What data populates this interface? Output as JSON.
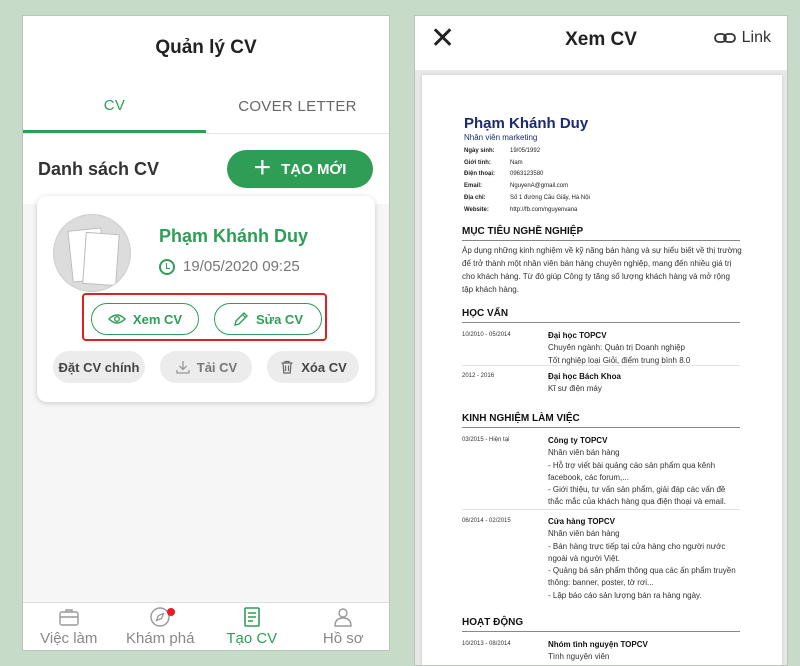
{
  "left": {
    "title": "Quản lý CV",
    "tabs": [
      {
        "label": "CV"
      },
      {
        "label": "COVER LETTER"
      }
    ],
    "section_title": "Danh sách CV",
    "create_label": "TẠO MỚI",
    "card": {
      "name": "Phạm Khánh Duy",
      "date": "19/05/2020 09:25",
      "view_label": "Xem CV",
      "edit_label": "Sửa CV",
      "set_main_label": "Đặt CV chính",
      "download_label": "Tải CV",
      "delete_label": "Xóa CV"
    },
    "nav": [
      {
        "label": "Việc làm",
        "icon": "briefcase-icon"
      },
      {
        "label": "Khám phá",
        "icon": "compass-icon"
      },
      {
        "label": "Tạo CV",
        "icon": "document-icon"
      },
      {
        "label": "Hồ sơ",
        "icon": "user-icon"
      }
    ]
  },
  "right": {
    "title": "Xem CV",
    "link_label": "Link",
    "cv": {
      "name": "Phạm Khánh Duy",
      "role": "Nhân viên marketing",
      "info": [
        {
          "k": "Ngày sinh:",
          "v": "19/05/1992"
        },
        {
          "k": "Giới tính:",
          "v": "Nam"
        },
        {
          "k": "Điện thoại:",
          "v": "0963123580"
        },
        {
          "k": "Email:",
          "v": "NguyenA@gmail.com"
        },
        {
          "k": "Địa chỉ:",
          "v": "Số 1 đường Cầu Giấy, Hà Nội"
        },
        {
          "k": "Website:",
          "v": "http://fb.com/nguyenvana"
        }
      ],
      "objective_title": "MỤC TIÊU NGHỀ NGHIỆP",
      "objective": "Áp dụng những kinh nghiệm về kỹ năng bán hàng và sự hiểu biết về thị trường để trở thành một nhân viên bán hàng chuyên nghiệp, mang đến nhiều giá trị cho khách hàng. Từ đó giúp Công ty tăng số lượng khách hàng và mở rộng tập khách hàng.",
      "education_title": "HỌC VẤN",
      "education": [
        {
          "period": "10/2010 - 05/2014",
          "title": "Đại học TOPCV",
          "lines": [
            "Chuyên ngành: Quản trị Doanh nghiệp",
            "Tốt nghiệp loại Giỏi, điểm trung bình 8.0"
          ]
        },
        {
          "period": "2012 - 2016",
          "title": "Đại học Bách Khoa",
          "lines": [
            "Kĩ sư điện máy"
          ]
        }
      ],
      "experience_title": "KINH NGHIỆM LÀM VIỆC",
      "experience": [
        {
          "period": "03/2015 - Hiện tại",
          "title": "Công ty TOPCV",
          "lines": [
            "Nhân viên bán hàng",
            "- Hỗ trợ viết bài quảng cáo sản phẩm qua kênh facebook, các forum,...",
            "- Giới thiệu, tư vấn sản phẩm, giải đáp các vấn đề thắc mắc của khách hàng qua điện thoại và email."
          ]
        },
        {
          "period": "06/2014 - 02/2015",
          "title": "Cửa hàng TOPCV",
          "lines": [
            "Nhân viên bán hàng",
            "- Bán hàng trực tiếp tại cửa hàng cho người nước ngoài và người Việt.",
            "- Quảng bá sản phẩm thông qua các ấn phẩm truyền thông: banner, poster, tờ rơi...",
            "- Lập báo cáo sản lượng bán ra hàng ngày."
          ]
        }
      ],
      "activities_title": "HOẠT ĐỘNG",
      "activities": [
        {
          "period": "10/2013 - 08/2014",
          "title": "Nhóm tình nguyện TOPCV",
          "lines": [
            "Tình nguyện viên"
          ]
        }
      ]
    }
  },
  "colors": {
    "accent": "#2e9e57",
    "highlight": "#e02020",
    "navy": "#1c2a70",
    "background": "#c6dcc8"
  }
}
